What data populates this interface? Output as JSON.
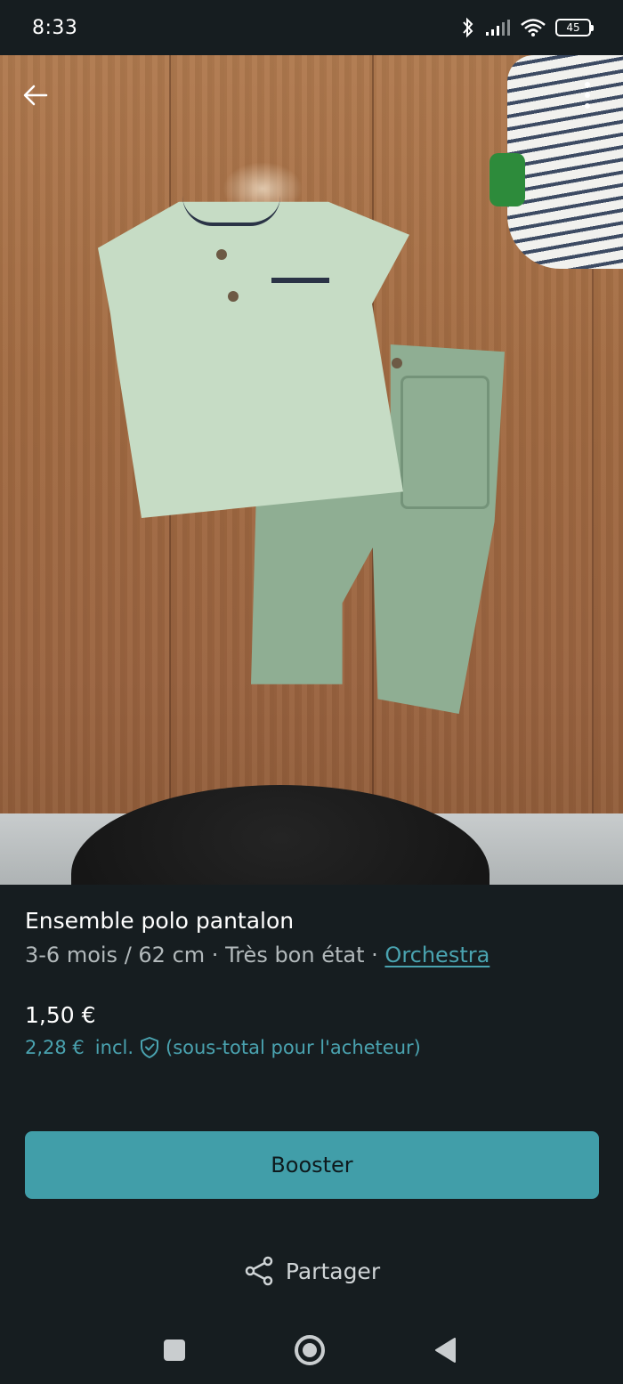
{
  "status_bar": {
    "time": "8:33",
    "battery": "45",
    "network_label": "6"
  },
  "item": {
    "title": "Ensemble polo pantalon",
    "size": "3-6 mois / 62 cm",
    "separator": "·",
    "condition": "Très bon état",
    "brand": "Orchestra",
    "price": "1,50 €",
    "buyer_price": "2,28 €",
    "buyer_price_incl": "incl.",
    "buyer_price_note": "(sous-total pour l'acheteur)"
  },
  "actions": {
    "booster_label": "Booster",
    "share_label": "Partager"
  },
  "colors": {
    "background": "#161d20",
    "accent": "#419ea9",
    "link": "#4aa3b0"
  },
  "icons": {
    "back": "arrow-left-icon",
    "more": "more-vertical-icon",
    "protection": "shield-check-icon",
    "share": "share-icon"
  }
}
